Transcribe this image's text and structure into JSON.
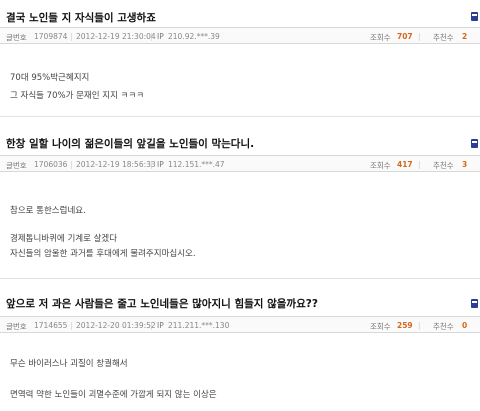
{
  "labels": {
    "post_no": "글번호",
    "ip": "IP",
    "views": "조회수",
    "recommends": "추천수"
  },
  "posts": [
    {
      "title": "결국 노인들 지 자식들이 고생하죠",
      "post_no": "1709874",
      "datetime": "2012-12-19 21:30:04",
      "ip": "210.92.***.39",
      "views": "707",
      "recommends": "2",
      "lines": [
        "70대 95%박근혜지지",
        "그 자식들 70%가 문재인 지지 ㅋㅋㅋ"
      ]
    },
    {
      "title": "한창 일할 나이의 젊은이들의 앞길을 노인들이 막는다니.",
      "post_no": "1706036",
      "datetime": "2012-12-19 18:56:33",
      "ip": "112.151.***.47",
      "views": "417",
      "recommends": "3",
      "lines": [
        "참으로 통한스럽네요.",
        "경제톱니바퀴에 기계로 살겠다",
        "자신들의 암울한 과거를 후대에게 물려주지마십시오."
      ]
    },
    {
      "title": "앞으로    저 과은 사람들은 줄고 노인네들은 많아지니 힘들지 않을까요??",
      "post_no": "1714655",
      "datetime": "2012-12-20 01:39:52",
      "ip": "211.211.***.130",
      "views": "259",
      "recommends": "0",
      "lines": [
        "무슨 바이러스나 괴질이 창궐해서",
        "면역력 약한 노인들이 괴멸수준에 가깝게 되지 않는 이상은"
      ]
    }
  ]
}
